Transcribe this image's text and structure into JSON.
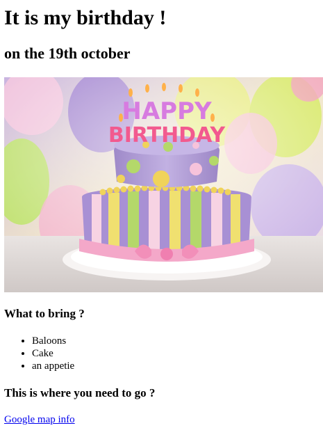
{
  "page": {
    "title": "It is my birthday !",
    "subtitle": "on the 19th october"
  },
  "hero_image": {
    "alt": "birthday cake",
    "cake_text_top": "HAPPY",
    "cake_text_bottom": "BIRTHDAY"
  },
  "bring_section": {
    "heading": "What to bring ?",
    "items": [
      "Baloons",
      "Cake",
      "an appetie"
    ]
  },
  "location_section": {
    "heading": "This is where you need to go ?",
    "link_text": "Google map info"
  },
  "colors": {
    "link": "#0000ee",
    "text": "#000000"
  }
}
